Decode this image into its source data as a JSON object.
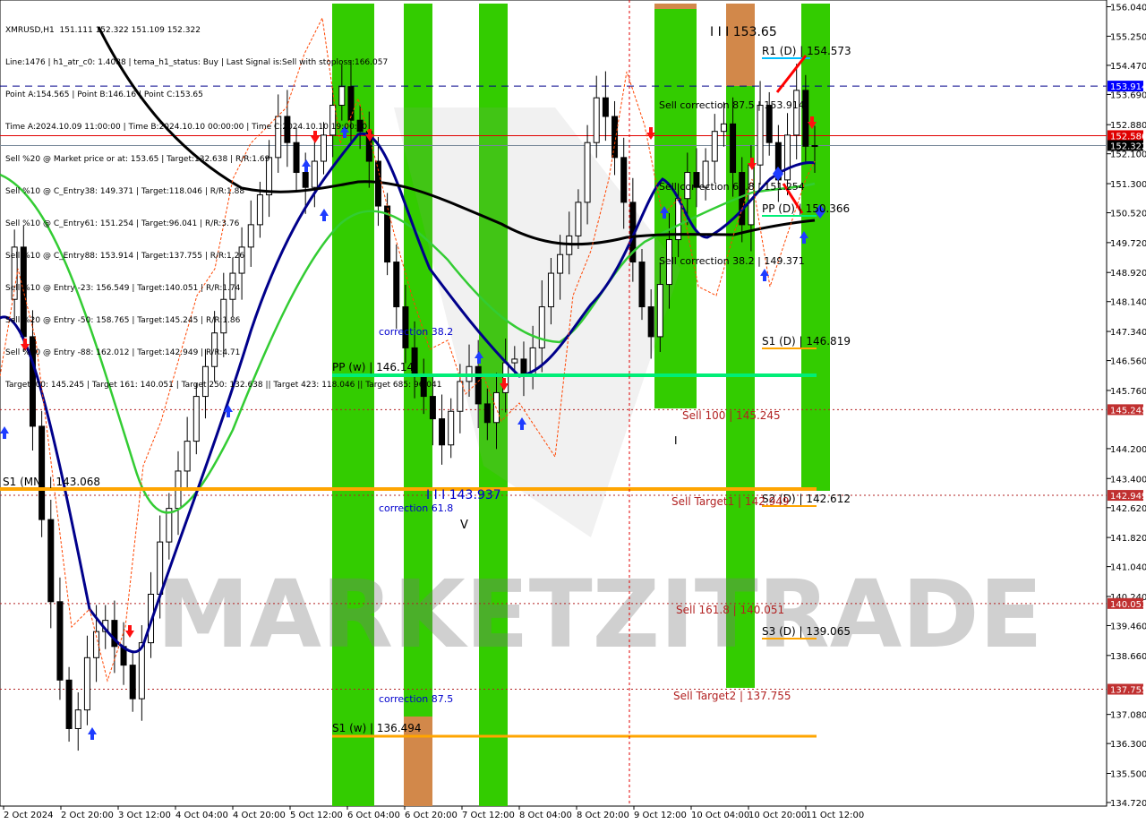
{
  "info": {
    "lines": [
      "XMRUSD,H1  151.111 152.322 151.109 152.322",
      "Line:1476 | h1_atr_c0: 1.4088 | tema_h1_status: Buy | Last Signal is:Sell with stoploss:166.057",
      "Point A:154.565 | Point B:146.16 | Point C:153.65",
      "Time A:2024.10.09 11:00:00 | Time B:2024.10.10 00:00:00 | Time C:2024.10.10 19:00:00",
      "Sell %20 @ Market price or at: 153.65 | Target:132.638 | R/R:1.69",
      "Sell %10 @ C_Entry38: 149.371 | Target:118.046 | R/R:1.88",
      "Sell %10 @ C_Entry61: 151.254 | Target:96.041 | R/R:3.76",
      "Sell %10 @ C_Entry88: 153.914 | Target:137.755 | R/R:1.26",
      "Sell %10 @ Entry -23: 156.549 | Target:140.051 | R/R:1.74",
      "Sell %20 @ Entry -50: 158.765 | Target:145.245 | R/R:1.86",
      "Sell %20 @ Entry -88: 162.012 | Target:142.949 | R/R:4.71",
      "Target100: 145.245 | Target 161: 140.051 | Target 250: 132.638 || Target 423: 118.046 || Target 685: 96.041"
    ]
  },
  "watermark": "MARKETZITRADE",
  "colors": {
    "green_zone": "#33cc00",
    "orange_zone": "#d2884a",
    "pivot_orange": "#ffa500",
    "pp_green": "#00ee77",
    "ma_black": "#000000",
    "ma_navy": "#00008b",
    "ma_green": "#33cc33",
    "red_label": "#b22222",
    "price_blue": "#0000ff"
  },
  "chart_data": {
    "type": "candlestick",
    "symbol": "XMRUSD",
    "timeframe": "H1",
    "ylim": [
      134.72,
      156.1
    ],
    "y_ticks": [
      "156.040",
      "155.250",
      "154.470",
      "153.690",
      "152.880",
      "152.100",
      "151.300",
      "150.520",
      "149.720",
      "148.920",
      "148.140",
      "147.340",
      "146.560",
      "145.760",
      "144.200",
      "143.400",
      "142.620",
      "141.820",
      "141.040",
      "140.240",
      "139.460",
      "138.660",
      "137.080",
      "136.300",
      "135.500",
      "134.720"
    ],
    "x_ticks": [
      "2 Oct 2024",
      "2 Oct 20:00",
      "3 Oct 12:00",
      "4 Oct 04:00",
      "4 Oct 20:00",
      "5 Oct 12:00",
      "6 Oct 04:00",
      "6 Oct 20:00",
      "7 Oct 12:00",
      "8 Oct 04:00",
      "8 Oct 20:00",
      "9 Oct 12:00",
      "10 Oct 04:00",
      "10 Oct 20:00",
      "11 Oct 12:00"
    ],
    "price_tags": [
      {
        "label": "153.914",
        "value": 153.914,
        "color": "#0000ff"
      },
      {
        "label": "152.586",
        "value": 152.586,
        "color": "#e00000"
      },
      {
        "label": "152.322",
        "value": 152.322,
        "color": "#000000"
      },
      {
        "label": "145.245",
        "value": 145.245,
        "color": "#c03030"
      },
      {
        "label": "142.949",
        "value": 142.949,
        "color": "#c03030"
      },
      {
        "label": "140.051",
        "value": 140.051,
        "color": "#c03030"
      },
      {
        "label": "137.755",
        "value": 137.755,
        "color": "#c03030"
      }
    ],
    "hlines": [
      {
        "value": 153.914,
        "style": "dash",
        "color": "#00008b"
      },
      {
        "value": 152.586,
        "style": "solid",
        "color": "#e00000"
      },
      {
        "value": 152.322,
        "style": "solid",
        "color": "#778899"
      },
      {
        "value": 145.245,
        "style": "dot",
        "color": "#b22222"
      },
      {
        "value": 142.949,
        "style": "dot",
        "color": "#b22222"
      },
      {
        "value": 140.051,
        "style": "dot",
        "color": "#b22222"
      },
      {
        "value": 137.755,
        "style": "dot",
        "color": "#b22222"
      }
    ],
    "levels": [
      {
        "label": "R1 (D) | 154.573",
        "value": 154.573,
        "color": "#00bfff"
      },
      {
        "label": "PP (D) | 150.366",
        "value": 150.366,
        "color": "#00ee77"
      },
      {
        "label": "S1 (D) | 146.819",
        "value": 146.819,
        "color": "#ffa500"
      },
      {
        "label": "S2 (D) | 142.612",
        "value": 142.612,
        "color": "#ffa500"
      },
      {
        "label": "S3 (D) | 139.065",
        "value": 139.065,
        "color": "#ffa500"
      },
      {
        "label": "PP (w) | 146.14",
        "value": 146.14,
        "color": "#00ee77"
      },
      {
        "label": "S1 (w) | 136.494",
        "value": 136.494,
        "color": "#ffa500"
      },
      {
        "label": "S1 (MN) | 143.068",
        "value": 143.068,
        "color": "#ffa500"
      }
    ],
    "annotations": [
      {
        "text": "I I I 153.65",
        "color": "#000000"
      },
      {
        "text": "Sell correction 87.5 | 153.914",
        "color": "#000000"
      },
      {
        "text": "Sell correction 61.8 | 151.254",
        "color": "#000000"
      },
      {
        "text": "Sell correction 38.2 | 149.371",
        "color": "#000000"
      },
      {
        "text": "Sell 100 | 145.245",
        "color": "#b22222"
      },
      {
        "text": "I",
        "color": "#000000"
      },
      {
        "text": "I I I 143.937",
        "color": "#0000cd"
      },
      {
        "text": "V",
        "color": "#000000"
      },
      {
        "text": "Sell Target1 | 142.949",
        "color": "#b22222"
      },
      {
        "text": "Sell 161.8 | 140.051",
        "color": "#b22222"
      },
      {
        "text": "Sell Target2 | 137.755",
        "color": "#b22222"
      },
      {
        "text": "correction 38.2",
        "color": "#0000cd"
      },
      {
        "text": "correction 61.8",
        "color": "#0000cd"
      },
      {
        "text": "correction 87.5",
        "color": "#0000cd"
      }
    ],
    "close_series": [
      148.2,
      149.6,
      147.2,
      144.8,
      142.3,
      140.1,
      138.0,
      136.7,
      137.2,
      138.6,
      139.3,
      139.6,
      138.9,
      138.4,
      137.5,
      139.0,
      140.3,
      141.7,
      142.6,
      143.6,
      144.4,
      145.6,
      146.4,
      147.3,
      148.2,
      148.9,
      149.6,
      150.2,
      151.0,
      152.0,
      153.1,
      152.4,
      151.6,
      151.2,
      151.9,
      152.6,
      153.4,
      153.9,
      153.0,
      152.7,
      151.9,
      150.7,
      149.2,
      148.0,
      146.9,
      146.2,
      145.6,
      145.0,
      144.3,
      145.2,
      146.0,
      146.4,
      145.4,
      144.9,
      145.7,
      146.5,
      146.6,
      146.2,
      146.9,
      148.0,
      148.9,
      149.4,
      149.9,
      150.8,
      152.4,
      153.6,
      153.1,
      152.0,
      150.8,
      149.2,
      148.0,
      147.2,
      148.6,
      149.8,
      150.9,
      151.6,
      151.2,
      151.9,
      152.7,
      152.9,
      151.6,
      150.2,
      151.8,
      153.4,
      152.4,
      151.4,
      152.6,
      153.8,
      152.3,
      152.32
    ]
  }
}
